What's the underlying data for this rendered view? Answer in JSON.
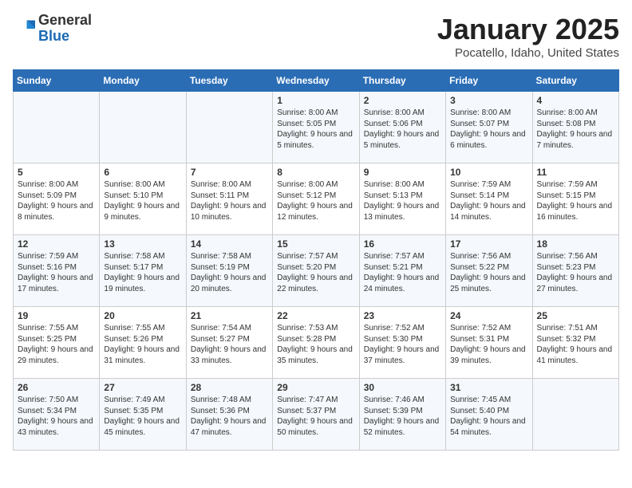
{
  "header": {
    "logo_general": "General",
    "logo_blue": "Blue",
    "title": "January 2025",
    "subtitle": "Pocatello, Idaho, United States"
  },
  "days_of_week": [
    "Sunday",
    "Monday",
    "Tuesday",
    "Wednesday",
    "Thursday",
    "Friday",
    "Saturday"
  ],
  "weeks": [
    [
      {
        "day": "",
        "info": ""
      },
      {
        "day": "",
        "info": ""
      },
      {
        "day": "",
        "info": ""
      },
      {
        "day": "1",
        "info": "Sunrise: 8:00 AM\nSunset: 5:05 PM\nDaylight: 9 hours and 5 minutes."
      },
      {
        "day": "2",
        "info": "Sunrise: 8:00 AM\nSunset: 5:06 PM\nDaylight: 9 hours and 5 minutes."
      },
      {
        "day": "3",
        "info": "Sunrise: 8:00 AM\nSunset: 5:07 PM\nDaylight: 9 hours and 6 minutes."
      },
      {
        "day": "4",
        "info": "Sunrise: 8:00 AM\nSunset: 5:08 PM\nDaylight: 9 hours and 7 minutes."
      }
    ],
    [
      {
        "day": "5",
        "info": "Sunrise: 8:00 AM\nSunset: 5:09 PM\nDaylight: 9 hours and 8 minutes."
      },
      {
        "day": "6",
        "info": "Sunrise: 8:00 AM\nSunset: 5:10 PM\nDaylight: 9 hours and 9 minutes."
      },
      {
        "day": "7",
        "info": "Sunrise: 8:00 AM\nSunset: 5:11 PM\nDaylight: 9 hours and 10 minutes."
      },
      {
        "day": "8",
        "info": "Sunrise: 8:00 AM\nSunset: 5:12 PM\nDaylight: 9 hours and 12 minutes."
      },
      {
        "day": "9",
        "info": "Sunrise: 8:00 AM\nSunset: 5:13 PM\nDaylight: 9 hours and 13 minutes."
      },
      {
        "day": "10",
        "info": "Sunrise: 7:59 AM\nSunset: 5:14 PM\nDaylight: 9 hours and 14 minutes."
      },
      {
        "day": "11",
        "info": "Sunrise: 7:59 AM\nSunset: 5:15 PM\nDaylight: 9 hours and 16 minutes."
      }
    ],
    [
      {
        "day": "12",
        "info": "Sunrise: 7:59 AM\nSunset: 5:16 PM\nDaylight: 9 hours and 17 minutes."
      },
      {
        "day": "13",
        "info": "Sunrise: 7:58 AM\nSunset: 5:17 PM\nDaylight: 9 hours and 19 minutes."
      },
      {
        "day": "14",
        "info": "Sunrise: 7:58 AM\nSunset: 5:19 PM\nDaylight: 9 hours and 20 minutes."
      },
      {
        "day": "15",
        "info": "Sunrise: 7:57 AM\nSunset: 5:20 PM\nDaylight: 9 hours and 22 minutes."
      },
      {
        "day": "16",
        "info": "Sunrise: 7:57 AM\nSunset: 5:21 PM\nDaylight: 9 hours and 24 minutes."
      },
      {
        "day": "17",
        "info": "Sunrise: 7:56 AM\nSunset: 5:22 PM\nDaylight: 9 hours and 25 minutes."
      },
      {
        "day": "18",
        "info": "Sunrise: 7:56 AM\nSunset: 5:23 PM\nDaylight: 9 hours and 27 minutes."
      }
    ],
    [
      {
        "day": "19",
        "info": "Sunrise: 7:55 AM\nSunset: 5:25 PM\nDaylight: 9 hours and 29 minutes."
      },
      {
        "day": "20",
        "info": "Sunrise: 7:55 AM\nSunset: 5:26 PM\nDaylight: 9 hours and 31 minutes."
      },
      {
        "day": "21",
        "info": "Sunrise: 7:54 AM\nSunset: 5:27 PM\nDaylight: 9 hours and 33 minutes."
      },
      {
        "day": "22",
        "info": "Sunrise: 7:53 AM\nSunset: 5:28 PM\nDaylight: 9 hours and 35 minutes."
      },
      {
        "day": "23",
        "info": "Sunrise: 7:52 AM\nSunset: 5:30 PM\nDaylight: 9 hours and 37 minutes."
      },
      {
        "day": "24",
        "info": "Sunrise: 7:52 AM\nSunset: 5:31 PM\nDaylight: 9 hours and 39 minutes."
      },
      {
        "day": "25",
        "info": "Sunrise: 7:51 AM\nSunset: 5:32 PM\nDaylight: 9 hours and 41 minutes."
      }
    ],
    [
      {
        "day": "26",
        "info": "Sunrise: 7:50 AM\nSunset: 5:34 PM\nDaylight: 9 hours and 43 minutes."
      },
      {
        "day": "27",
        "info": "Sunrise: 7:49 AM\nSunset: 5:35 PM\nDaylight: 9 hours and 45 minutes."
      },
      {
        "day": "28",
        "info": "Sunrise: 7:48 AM\nSunset: 5:36 PM\nDaylight: 9 hours and 47 minutes."
      },
      {
        "day": "29",
        "info": "Sunrise: 7:47 AM\nSunset: 5:37 PM\nDaylight: 9 hours and 50 minutes."
      },
      {
        "day": "30",
        "info": "Sunrise: 7:46 AM\nSunset: 5:39 PM\nDaylight: 9 hours and 52 minutes."
      },
      {
        "day": "31",
        "info": "Sunrise: 7:45 AM\nSunset: 5:40 PM\nDaylight: 9 hours and 54 minutes."
      },
      {
        "day": "",
        "info": ""
      }
    ]
  ]
}
